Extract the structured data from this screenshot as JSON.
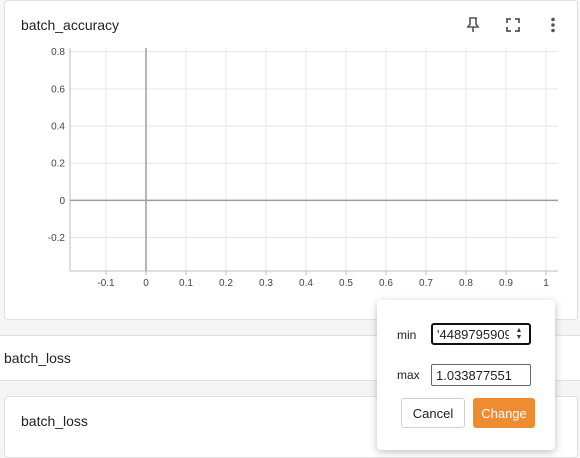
{
  "accuracy_card": {
    "title": "batch_accuracy",
    "icons": [
      "pin-icon",
      "fullscreen-icon",
      "more-vert-icon"
    ]
  },
  "loss_section": {
    "title": "batch_loss"
  },
  "loss_card": {
    "title": "batch_loss"
  },
  "chart_data": {
    "type": "line",
    "title": "batch_accuracy",
    "xlabel": "",
    "ylabel": "",
    "xlim": [
      -0.19,
      1.03
    ],
    "ylim": [
      -0.38,
      0.82
    ],
    "x_ticks": [
      "-0.1",
      "0",
      "0.1",
      "0.2",
      "0.3",
      "0.4",
      "0.5",
      "0.6",
      "0.7",
      "0.8",
      "0.9",
      "1"
    ],
    "x_tick_values": [
      -0.1,
      0,
      0.1,
      0.2,
      0.3,
      0.4,
      0.5,
      0.6,
      0.7,
      0.8,
      0.9,
      1
    ],
    "y_ticks": [
      "0.8",
      "0.6",
      "0.4",
      "0.2",
      "0",
      "-0.2"
    ],
    "y_tick_values": [
      0.8,
      0.6,
      0.4,
      0.2,
      0,
      -0.2
    ],
    "series": [],
    "grid": true
  },
  "range_popup": {
    "min_label": "min",
    "min_value": "'4489795909",
    "max_label": "max",
    "max_value": "1.033877551",
    "cancel_label": "Cancel",
    "change_label": "Change"
  },
  "colors": {
    "accent": "#ef8c31",
    "grid": "#e6e6e6",
    "zero_axis": "#9e9e9e"
  }
}
